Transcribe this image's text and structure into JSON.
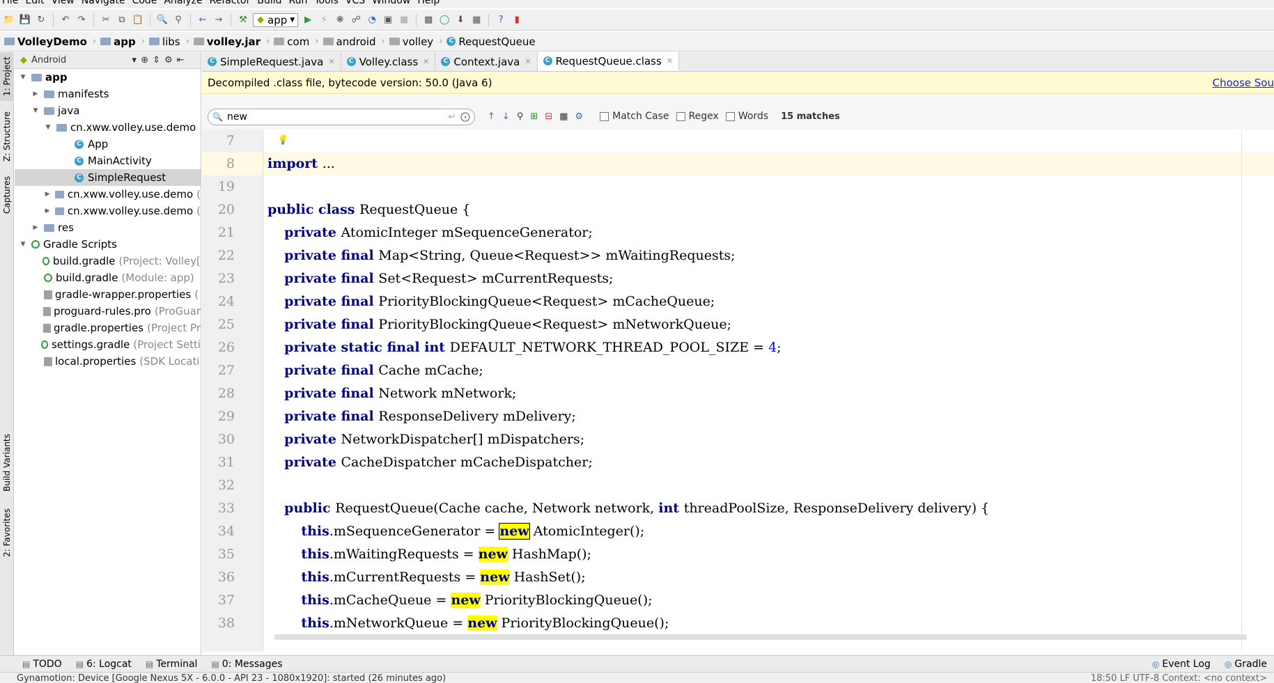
{
  "menu": [
    "File",
    "Edit",
    "View",
    "Navigate",
    "Code",
    "Analyze",
    "Refactor",
    "Build",
    "Run",
    "Tools",
    "VCS",
    "Window",
    "Help"
  ],
  "toolbar": {
    "run_config": "app"
  },
  "breadcrumb": [
    "VolleyDemo",
    "app",
    "libs",
    "volley.jar",
    "com",
    "android",
    "volley",
    "RequestQueue"
  ],
  "side_tabs": {
    "project": "1: Project",
    "structure": "Z: Structure",
    "captures": "Captures",
    "build_variants": "Build Variants",
    "favorites": "2: Favorites"
  },
  "project": {
    "view_mode": "Android",
    "tree": [
      {
        "label": "app",
        "note": "",
        "icon": "folder-icon",
        "depth": 0,
        "arrow": "▼",
        "bold": true,
        "selected": false
      },
      {
        "label": "manifests",
        "note": "",
        "icon": "folder-icon",
        "depth": 1,
        "arrow": "▶",
        "bold": false,
        "selected": false
      },
      {
        "label": "java",
        "note": "",
        "icon": "folder-icon",
        "depth": 1,
        "arrow": "▼",
        "bold": false,
        "selected": false
      },
      {
        "label": "cn.xww.volley.use.demo",
        "note": "",
        "icon": "package-icon",
        "depth": 2,
        "arrow": "▼",
        "bold": false,
        "selected": false
      },
      {
        "label": "App",
        "note": "",
        "icon": "class-icon",
        "depth": 3,
        "arrow": "",
        "bold": false,
        "selected": false
      },
      {
        "label": "MainActivity",
        "note": "",
        "icon": "class-icon",
        "depth": 3,
        "arrow": "",
        "bold": false,
        "selected": false
      },
      {
        "label": "SimpleRequest",
        "note": "",
        "icon": "class-icon",
        "depth": 3,
        "arrow": "",
        "bold": false,
        "selected": true
      },
      {
        "label": "cn.xww.volley.use.demo",
        "note": "(",
        "icon": "package-icon",
        "depth": 2,
        "arrow": "▶",
        "bold": false,
        "selected": false
      },
      {
        "label": "cn.xww.volley.use.demo",
        "note": "(",
        "icon": "package-icon",
        "depth": 2,
        "arrow": "▶",
        "bold": false,
        "selected": false
      },
      {
        "label": "res",
        "note": "",
        "icon": "folder-icon",
        "depth": 1,
        "arrow": "▶",
        "bold": false,
        "selected": false
      },
      {
        "label": "Gradle Scripts",
        "note": "",
        "icon": "gradle-icon",
        "depth": 0,
        "arrow": "▼",
        "bold": false,
        "selected": false
      },
      {
        "label": "build.gradle",
        "note": "(Project: Volley[",
        "icon": "gradle-icon",
        "depth": 1,
        "arrow": "",
        "bold": false,
        "selected": false
      },
      {
        "label": "build.gradle",
        "note": "(Module: app)",
        "icon": "gradle-icon",
        "depth": 1,
        "arrow": "",
        "bold": false,
        "selected": false
      },
      {
        "label": "gradle-wrapper.properties",
        "note": "(",
        "icon": "properties-icon",
        "depth": 1,
        "arrow": "",
        "bold": false,
        "selected": false
      },
      {
        "label": "proguard-rules.pro",
        "note": "(ProGuar",
        "icon": "properties-icon",
        "depth": 1,
        "arrow": "",
        "bold": false,
        "selected": false
      },
      {
        "label": "gradle.properties",
        "note": "(Project Pr",
        "icon": "properties-icon",
        "depth": 1,
        "arrow": "",
        "bold": false,
        "selected": false
      },
      {
        "label": "settings.gradle",
        "note": "(Project Setti",
        "icon": "gradle-icon",
        "depth": 1,
        "arrow": "",
        "bold": false,
        "selected": false
      },
      {
        "label": "local.properties",
        "note": "(SDK Locati",
        "icon": "properties-icon",
        "depth": 1,
        "arrow": "",
        "bold": false,
        "selected": false
      }
    ]
  },
  "tabs": [
    {
      "label": "SimpleRequest.java",
      "active": false
    },
    {
      "label": "Volley.class",
      "active": false
    },
    {
      "label": "Context.java",
      "active": false
    },
    {
      "label": "RequestQueue.class",
      "active": true
    }
  ],
  "decompiled": {
    "message": "Decompiled .class file, bytecode version: 50.0 (Java 6)",
    "link": "Choose Sou"
  },
  "find": {
    "query": "new",
    "match_case": "Match Case",
    "regex": "Regex",
    "words": "Words",
    "matches": "15 matches"
  },
  "lines": [
    {
      "n": "7",
      "cur": false,
      "parts": []
    },
    {
      "n": "8",
      "cur": true,
      "parts": [
        {
          "t": "import ",
          "c": "kw"
        },
        {
          "t": "...",
          "c": ""
        }
      ]
    },
    {
      "n": "19",
      "cur": false,
      "parts": []
    },
    {
      "n": "20",
      "cur": false,
      "parts": [
        {
          "t": "public class ",
          "c": "kw"
        },
        {
          "t": "RequestQueue {",
          "c": ""
        }
      ]
    },
    {
      "n": "21",
      "cur": false,
      "parts": [
        {
          "t": "    "
        },
        {
          "t": "private ",
          "c": "kw"
        },
        {
          "t": "AtomicInteger mSequenceGenerator;",
          "c": ""
        }
      ]
    },
    {
      "n": "22",
      "cur": false,
      "parts": [
        {
          "t": "    "
        },
        {
          "t": "private final ",
          "c": "kw"
        },
        {
          "t": "Map<String, Queue<Request>> mWaitingRequests;",
          "c": ""
        }
      ]
    },
    {
      "n": "23",
      "cur": false,
      "parts": [
        {
          "t": "    "
        },
        {
          "t": "private final ",
          "c": "kw"
        },
        {
          "t": "Set<Request> mCurrentRequests;",
          "c": ""
        }
      ]
    },
    {
      "n": "24",
      "cur": false,
      "parts": [
        {
          "t": "    "
        },
        {
          "t": "private final ",
          "c": "kw"
        },
        {
          "t": "PriorityBlockingQueue<Request> mCacheQueue;",
          "c": ""
        }
      ]
    },
    {
      "n": "25",
      "cur": false,
      "parts": [
        {
          "t": "    "
        },
        {
          "t": "private final ",
          "c": "kw"
        },
        {
          "t": "PriorityBlockingQueue<Request> mNetworkQueue;",
          "c": ""
        }
      ]
    },
    {
      "n": "26",
      "cur": false,
      "parts": [
        {
          "t": "    "
        },
        {
          "t": "private static final int ",
          "c": "kw"
        },
        {
          "t": "DEFAULT_NETWORK_THREAD_POOL_SIZE = ",
          "c": ""
        },
        {
          "t": "4",
          "c": "num"
        },
        {
          "t": ";",
          "c": ""
        }
      ]
    },
    {
      "n": "27",
      "cur": false,
      "parts": [
        {
          "t": "    "
        },
        {
          "t": "private final ",
          "c": "kw"
        },
        {
          "t": "Cache mCache;",
          "c": ""
        }
      ]
    },
    {
      "n": "28",
      "cur": false,
      "parts": [
        {
          "t": "    "
        },
        {
          "t": "private final ",
          "c": "kw"
        },
        {
          "t": "Network mNetwork;",
          "c": ""
        }
      ]
    },
    {
      "n": "29",
      "cur": false,
      "parts": [
        {
          "t": "    "
        },
        {
          "t": "private final ",
          "c": "kw"
        },
        {
          "t": "ResponseDelivery mDelivery;",
          "c": ""
        }
      ]
    },
    {
      "n": "30",
      "cur": false,
      "parts": [
        {
          "t": "    "
        },
        {
          "t": "private ",
          "c": "kw"
        },
        {
          "t": "NetworkDispatcher[] mDispatchers;",
          "c": ""
        }
      ]
    },
    {
      "n": "31",
      "cur": false,
      "parts": [
        {
          "t": "    "
        },
        {
          "t": "private ",
          "c": "kw"
        },
        {
          "t": "CacheDispatcher mCacheDispatcher;",
          "c": ""
        }
      ]
    },
    {
      "n": "32",
      "cur": false,
      "parts": []
    },
    {
      "n": "33",
      "cur": false,
      "parts": [
        {
          "t": "    "
        },
        {
          "t": "public ",
          "c": "kw"
        },
        {
          "t": "RequestQueue(Cache cache, Network network, ",
          "c": ""
        },
        {
          "t": "int ",
          "c": "kw"
        },
        {
          "t": "threadPoolSize, ResponseDelivery delivery) {",
          "c": ""
        }
      ]
    },
    {
      "n": "34",
      "cur": false,
      "parts": [
        {
          "t": "        "
        },
        {
          "t": "this",
          "c": "kw"
        },
        {
          "t": ".mSequenceGenerator = ",
          "c": ""
        },
        {
          "t": "new",
          "c": "kw hl box"
        },
        {
          "t": " AtomicInteger();",
          "c": ""
        }
      ]
    },
    {
      "n": "35",
      "cur": false,
      "parts": [
        {
          "t": "        "
        },
        {
          "t": "this",
          "c": "kw"
        },
        {
          "t": ".mWaitingRequests = ",
          "c": ""
        },
        {
          "t": "new",
          "c": "kw hl"
        },
        {
          "t": " HashMap();",
          "c": ""
        }
      ]
    },
    {
      "n": "36",
      "cur": false,
      "parts": [
        {
          "t": "        "
        },
        {
          "t": "this",
          "c": "kw"
        },
        {
          "t": ".mCurrentRequests = ",
          "c": ""
        },
        {
          "t": "new",
          "c": "kw hl"
        },
        {
          "t": " HashSet();",
          "c": ""
        }
      ]
    },
    {
      "n": "37",
      "cur": false,
      "parts": [
        {
          "t": "        "
        },
        {
          "t": "this",
          "c": "kw"
        },
        {
          "t": ".mCacheQueue = ",
          "c": ""
        },
        {
          "t": "new",
          "c": "kw hl"
        },
        {
          "t": " PriorityBlockingQueue();",
          "c": ""
        }
      ]
    },
    {
      "n": "38",
      "cur": false,
      "parts": [
        {
          "t": "        "
        },
        {
          "t": "this",
          "c": "kw"
        },
        {
          "t": ".mNetworkQueue = ",
          "c": ""
        },
        {
          "t": "new",
          "c": "kw hl"
        },
        {
          "t": " PriorityBlockingQueue();",
          "c": ""
        }
      ]
    }
  ],
  "bottom_tools": [
    {
      "label": "TODO",
      "icon": "todo-icon"
    },
    {
      "label": "6: Logcat",
      "icon": "logcat-icon"
    },
    {
      "label": "Terminal",
      "icon": "terminal-icon"
    },
    {
      "label": "0: Messages",
      "icon": "messages-icon"
    }
  ],
  "bottom_right": [
    {
      "label": "Event Log",
      "icon": "event-log-icon"
    },
    {
      "label": "Gradle",
      "icon": "gradle-console-icon"
    }
  ],
  "status": {
    "text": "Gynamotion: Device [Google Nexus 5X - 6.0.0 - API 23 - 1080x1920]: started (26 minutes ago)",
    "right": "18:50   LF   UTF-8   Context: <no context>"
  },
  "colors": {
    "keyword": "#000080",
    "number": "#0000ff",
    "search_highlight": "#ffff00",
    "notice_bg": "#fefad2",
    "selection": "#d5d5d5"
  }
}
